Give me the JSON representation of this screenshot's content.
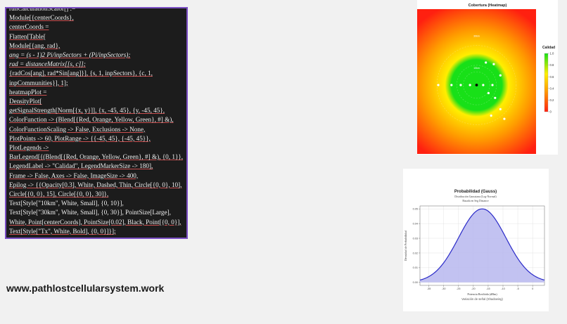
{
  "code": {
    "lines": [
      {
        "t": "runCalculationScalor[] :=",
        "u": false,
        "i": false
      },
      {
        "t": "Module[{centerCoords},",
        "u": true,
        "i": false
      },
      {
        "t": "centerCoords =",
        "u": true,
        "i": false
      },
      {
        "t": "Flatten[Table[",
        "u": true,
        "i": false
      },
      {
        "t": "Module[{ang, rad},",
        "u": true,
        "i": false
      },
      {
        "t": "ang = (s - 1)2 Pi/inpSectors + (Pi/inpSectors);",
        "u": true,
        "i": true
      },
      {
        "t": "rad = distanceMatrix[[s, c]];",
        "u": true,
        "i": true
      },
      {
        "t": "{radCos[ang], rad*Sin[ang]}], {s, 1, inpSectors}, {c, 1,",
        "u": true,
        "i": false
      },
      {
        "t": "inpCommunities}], 1];",
        "u": true,
        "i": false
      },
      {
        "t": "heatmapPlot =",
        "u": true,
        "i": false
      },
      {
        "t": "DensityPlot[",
        "u": true,
        "i": false
      },
      {
        "t": "getSignalStrength[Norm[{x, y}]], {x, -45, 45}, {y, -45, 45},",
        "u": true,
        "i": false
      },
      {
        "t": "ColorFunction -> (Blend[{Red, Orange, Yellow, Green}, #] &),",
        "u": true,
        "i": false
      },
      {
        "t": "ColorFunctionScaling -> False, Exclusions -> None,",
        "u": true,
        "i": false
      },
      {
        "t": "PlotPoints -> 60, PlotRange -> {{-45, 45}, {-45, 45}},",
        "u": true,
        "i": false
      },
      {
        "t": "PlotLegends ->",
        "u": true,
        "i": false
      },
      {
        "t": "BarLegend[{(Blend[{Red, Orange, Yellow, Green}, #] &), {0, 1}},",
        "u": true,
        "i": false
      },
      {
        "t": "LegendLabel -> \"Calidad\", LegendMarkerSize -> 180],",
        "u": true,
        "i": false
      },
      {
        "t": "Frame -> False, Axes -> False, ImageSize -> 400,",
        "u": true,
        "i": false
      },
      {
        "t": "Epilog -> {{Opacity[0.3], White, Dashed, Thin, Circle[{0, 0}, 10],",
        "u": true,
        "i": false
      },
      {
        "t": "Circle[{0, 0}, 15], Circle[{0, 0}, 30]},",
        "u": true,
        "i": false
      },
      {
        "t": "Text[Style[\"10km\", White, Small], {0, 10}],",
        "u": false,
        "i": false
      },
      {
        "t": "Text[Style[\"30km\", White, Small], {0, 30}], PointSize[Large],",
        "u": false,
        "i": false
      },
      {
        "t": "White, Point[centerCoords], PointSize[0.02], Black, Point[{0, 0}],",
        "u": true,
        "i": false
      },
      {
        "t": "Text[Style[\"Tx\", White, Bold], {0, 0}]}];",
        "u": true,
        "i": false
      },
      {
        "t": "calcGauss[];",
        "u": true,
        "i": false
      }
    ]
  },
  "site_url": "www.pathlostcellularsystem.work",
  "chart_data": [
    {
      "type": "heatmap",
      "title": "Cobertura (Heatmap)",
      "xlim": [
        -45,
        45
      ],
      "ylim": [
        -45,
        45
      ],
      "color_stops": [
        "#ff2010",
        "#ff9a00",
        "#ffee00",
        "#18e018"
      ],
      "legend": {
        "label": "Calidad",
        "ticks": [
          "1.0",
          "0.8",
          "0.6",
          "0.4",
          "0.2",
          "0"
        ],
        "placement": "right"
      },
      "annotations": [
        {
          "text": "30km",
          "x": 0,
          "y": 30
        },
        {
          "text": "10km",
          "x": 0,
          "y": 10
        }
      ],
      "transmitter": {
        "x": 0,
        "y": 0
      },
      "points": [
        {
          "x": -29,
          "y": 0
        },
        {
          "x": -19,
          "y": 0
        },
        {
          "x": -12,
          "y": 0
        },
        {
          "x": -5,
          "y": 0
        },
        {
          "x": 5,
          "y": 0
        },
        {
          "x": 12,
          "y": 0
        },
        {
          "x": 7,
          "y": 14
        },
        {
          "x": 13,
          "y": 13
        },
        {
          "x": 18,
          "y": 6
        },
        {
          "x": 9,
          "y": -5
        },
        {
          "x": 14,
          "y": -8
        },
        {
          "x": 18,
          "y": -15
        },
        {
          "x": 11,
          "y": -19
        },
        {
          "x": 21,
          "y": -21
        }
      ]
    },
    {
      "type": "area",
      "title": "Probabilidad (Gauss)",
      "subtitle_lines": [
        "Distribución Gaussiana (Log-Normal)",
        "Basada en Seg Distance"
      ],
      "xlabel": "Potencia Recibida (dBm)",
      "ylabel": "Densidad de Probabilidad",
      "footer": "Variación de señal (Shadowing)",
      "xlim": [
        -38,
        4
      ],
      "ylim": [
        -0.002,
        0.052
      ],
      "xticks": [
        -35,
        -30,
        -25,
        -20,
        -15,
        -10,
        -5,
        0
      ],
      "yticks": [
        0.0,
        0.01,
        0.02,
        0.03,
        0.04,
        0.05
      ],
      "ytick_labels": [
        "0.00",
        "0.01",
        "0.02",
        "0.03",
        "0.04",
        "0.05"
      ],
      "grid": true,
      "series": [
        {
          "mean": -17,
          "sd": 8,
          "peak": 0.05
        }
      ],
      "colors": {
        "line": "#2a2ac8",
        "fill": "#b7b7ee"
      }
    }
  ]
}
